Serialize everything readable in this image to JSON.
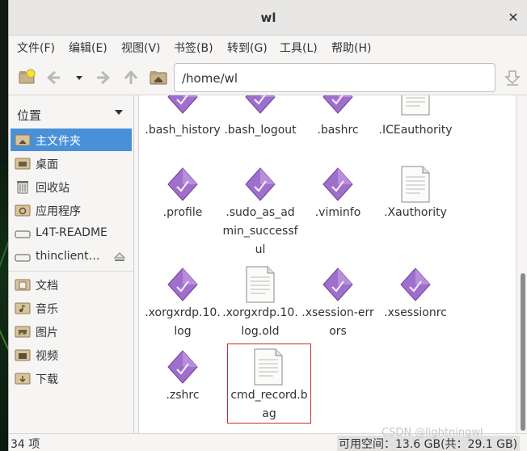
{
  "window": {
    "title": "wl"
  },
  "menu": [
    "文件(F)",
    "编辑(E)",
    "视图(V)",
    "书签(B)",
    "转到(G)",
    "工具(L)",
    "帮助(H)"
  ],
  "location": {
    "path": "/home/wl"
  },
  "sidebar": {
    "header": "位置",
    "items": [
      {
        "label": "主文件夹",
        "icon": "home-folder-icon",
        "active": true
      },
      {
        "label": "桌面",
        "icon": "desktop-icon"
      },
      {
        "label": "回收站",
        "icon": "trash-icon"
      },
      {
        "label": "应用程序",
        "icon": "applications-icon"
      },
      {
        "label": "L4T-README",
        "icon": "drive-icon"
      },
      {
        "label": "thinclient…",
        "icon": "drive-icon",
        "eject": true
      },
      {
        "label": "文档",
        "icon": "folder-icon"
      },
      {
        "label": "音乐",
        "icon": "music-folder-icon"
      },
      {
        "label": "图片",
        "icon": "pictures-folder-icon"
      },
      {
        "label": "视频",
        "icon": "videos-folder-icon"
      },
      {
        "label": "下载",
        "icon": "downloads-folder-icon"
      }
    ]
  },
  "files": [
    {
      "name": ".bash_history",
      "icon": "script-icon"
    },
    {
      "name": ".bash_logout",
      "icon": "script-icon"
    },
    {
      "name": ".bashrc",
      "icon": "script-icon"
    },
    {
      "name": ".ICEauthority",
      "icon": "text-file-icon"
    },
    {
      "name": ".profile",
      "icon": "script-icon"
    },
    {
      "name": ".sudo_as_admin_successful",
      "icon": "script-icon"
    },
    {
      "name": ".viminfo",
      "icon": "script-icon"
    },
    {
      "name": ".Xauthority",
      "icon": "text-file-icon"
    },
    {
      "name": ".xorgxrdp.10.log",
      "icon": "script-icon"
    },
    {
      "name": ".xorgxrdp.10.log.old",
      "icon": "text-file-icon"
    },
    {
      "name": ".xsession-errors",
      "icon": "script-icon"
    },
    {
      "name": ".xsessionrc",
      "icon": "script-icon"
    },
    {
      "name": ".zshrc",
      "icon": "script-icon"
    },
    {
      "name": "cmd_record.bag",
      "icon": "text-file-icon",
      "highlighted": true
    }
  ],
  "status": {
    "count": "34 项",
    "free_space": "可用空间：13.6 GB(共：29.1 GB)"
  },
  "watermark": "CSDN @lightningwl",
  "colors": {
    "selection": "#4a90d9",
    "script_icon": "#8f5bbd",
    "highlight_box": "#cc2b2b"
  }
}
